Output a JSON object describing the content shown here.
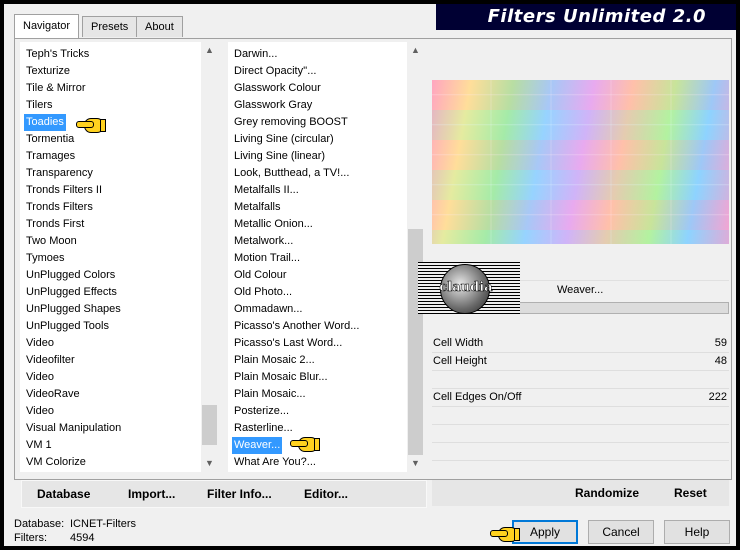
{
  "app": {
    "title": "Filters Unlimited 2.0"
  },
  "tabs": [
    {
      "label": "Navigator",
      "active": true
    },
    {
      "label": "Presets",
      "active": false
    },
    {
      "label": "About",
      "active": false
    }
  ],
  "categories": {
    "items": [
      "Teph's Tricks",
      "Texturize",
      "Tile & Mirror",
      "Tilers",
      "Toadies",
      "Tormentia",
      "Tramages",
      "Transparency",
      "Tronds Filters II",
      "Tronds Filters",
      "Tronds First",
      "Two Moon",
      "Tymoes",
      "UnPlugged Colors",
      "UnPlugged Effects",
      "UnPlugged Shapes",
      "UnPlugged Tools",
      "Video",
      "Videofilter",
      "Video",
      "VideoRave",
      "Video",
      "Visual Manipulation",
      "VM 1",
      "VM Colorize"
    ],
    "selected": "Toadies"
  },
  "filters": {
    "items": [
      "Darwin...",
      "Direct Opacity''...",
      "Glasswork Colour",
      "Glasswork Gray",
      "Grey removing BOOST",
      "Living Sine (circular)",
      "Living Sine (linear)",
      "Look, Butthead, a TV!...",
      "Metalfalls II...",
      "Metalfalls",
      "Metallic Onion...",
      "Metalwork...",
      "Motion Trail...",
      "Old Colour",
      "Old Photo...",
      "Ommadawn...",
      "Picasso's Another Word...",
      "Picasso's Last Word...",
      "Plain Mosaic 2...",
      "Plain Mosaic Blur...",
      "Plain Mosaic...",
      "Posterize...",
      "Rasterline...",
      "Weaver...",
      "What Are You?..."
    ],
    "selected": "Weaver..."
  },
  "preview": {
    "filter_name": "Weaver...",
    "watermark_text": "claudia"
  },
  "params": [
    {
      "label": "Cell Width",
      "value": "59"
    },
    {
      "label": "Cell Height",
      "value": "48"
    },
    {
      "label": "Cell Edges On/Off",
      "value": "222"
    }
  ],
  "toolbar": {
    "database_label": "Database",
    "import_label": "Import...",
    "filter_info_label": "Filter Info...",
    "editor_label": "Editor...",
    "randomize_label": "Randomize",
    "reset_label": "Reset"
  },
  "status": {
    "database_key": "Database:",
    "database_value": "ICNET-Filters",
    "filters_key": "Filters:",
    "filters_value": "4594"
  },
  "buttons": {
    "apply": "Apply",
    "cancel": "Cancel",
    "help": "Help"
  },
  "colors": {
    "title_bg": "#000033",
    "selection": "#3399ff",
    "pointer_hand": "#ffd21f"
  },
  "icons": [
    "pointer-hand-icon",
    "scroll-up-arrow-icon",
    "scroll-down-arrow-icon"
  ]
}
